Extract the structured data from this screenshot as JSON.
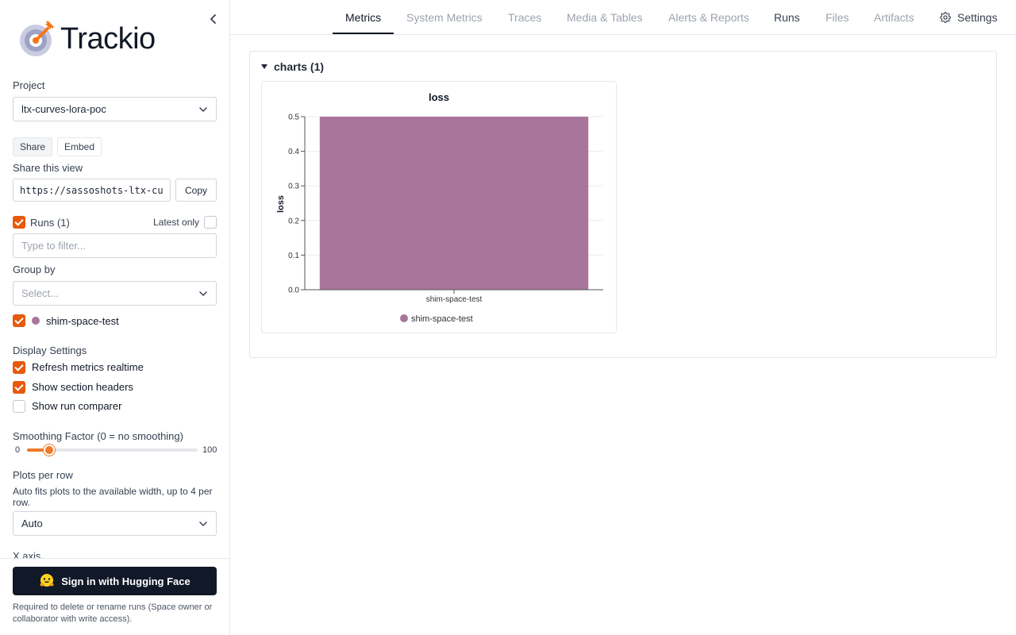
{
  "app": {
    "name": "Trackio"
  },
  "sidebar": {
    "project_label": "Project",
    "project_value": "ltx-curves-lora-poc",
    "share_button": "Share",
    "embed_button": "Embed",
    "share_view_label": "Share this view",
    "share_url": "https://sassoshots-ltx-cu",
    "copy_button": "Copy",
    "runs_label": "Runs (1)",
    "latest_only_label": "Latest only",
    "filter_placeholder": "Type to filter...",
    "group_by_label": "Group by",
    "group_by_placeholder": "Select...",
    "runs": [
      {
        "name": "shim-space-test",
        "color": "#a8759b",
        "checked": true
      }
    ],
    "display_settings_label": "Display Settings",
    "settings": [
      {
        "label": "Refresh metrics realtime",
        "checked": true
      },
      {
        "label": "Show section headers",
        "checked": true
      },
      {
        "label": "Show run comparer",
        "checked": false
      }
    ],
    "smoothing_label": "Smoothing Factor (0 = no smoothing)",
    "smoothing_min": "0",
    "smoothing_max": "100",
    "smoothing_value": 0.1,
    "plots_per_row_label": "Plots per row",
    "plots_per_row_help": "Auto fits plots to the available width, up to 4 per row.",
    "plots_per_row_value": "Auto",
    "x_axis_label": "X axis",
    "sign_in_button": "Sign in with Hugging Face",
    "sign_in_note": "Required to delete or rename runs (Space owner or collaborator with write access)."
  },
  "tabs": [
    {
      "label": "Metrics",
      "state": "active"
    },
    {
      "label": "System Metrics",
      "state": "muted"
    },
    {
      "label": "Traces",
      "state": "muted"
    },
    {
      "label": "Media & Tables",
      "state": "muted"
    },
    {
      "label": "Alerts & Reports",
      "state": "muted"
    },
    {
      "label": "Runs",
      "state": "dark"
    },
    {
      "label": "Files",
      "state": "muted"
    },
    {
      "label": "Artifacts",
      "state": "muted"
    },
    {
      "label": "Settings",
      "state": "dark",
      "icon": "gear-icon"
    }
  ],
  "section": {
    "title": "charts (1)"
  },
  "chart_data": {
    "type": "bar",
    "title": "loss",
    "xlabel": "",
    "ylabel": "loss",
    "categories": [
      "shim-space-test"
    ],
    "series": [
      {
        "name": "shim-space-test",
        "values": [
          0.5
        ],
        "color": "#a8759b"
      }
    ],
    "ylim": [
      0,
      0.5
    ],
    "yticks": [
      "0.0",
      "0.1",
      "0.2",
      "0.3",
      "0.4",
      "0.5"
    ],
    "grid": true,
    "legend": "bottom"
  }
}
